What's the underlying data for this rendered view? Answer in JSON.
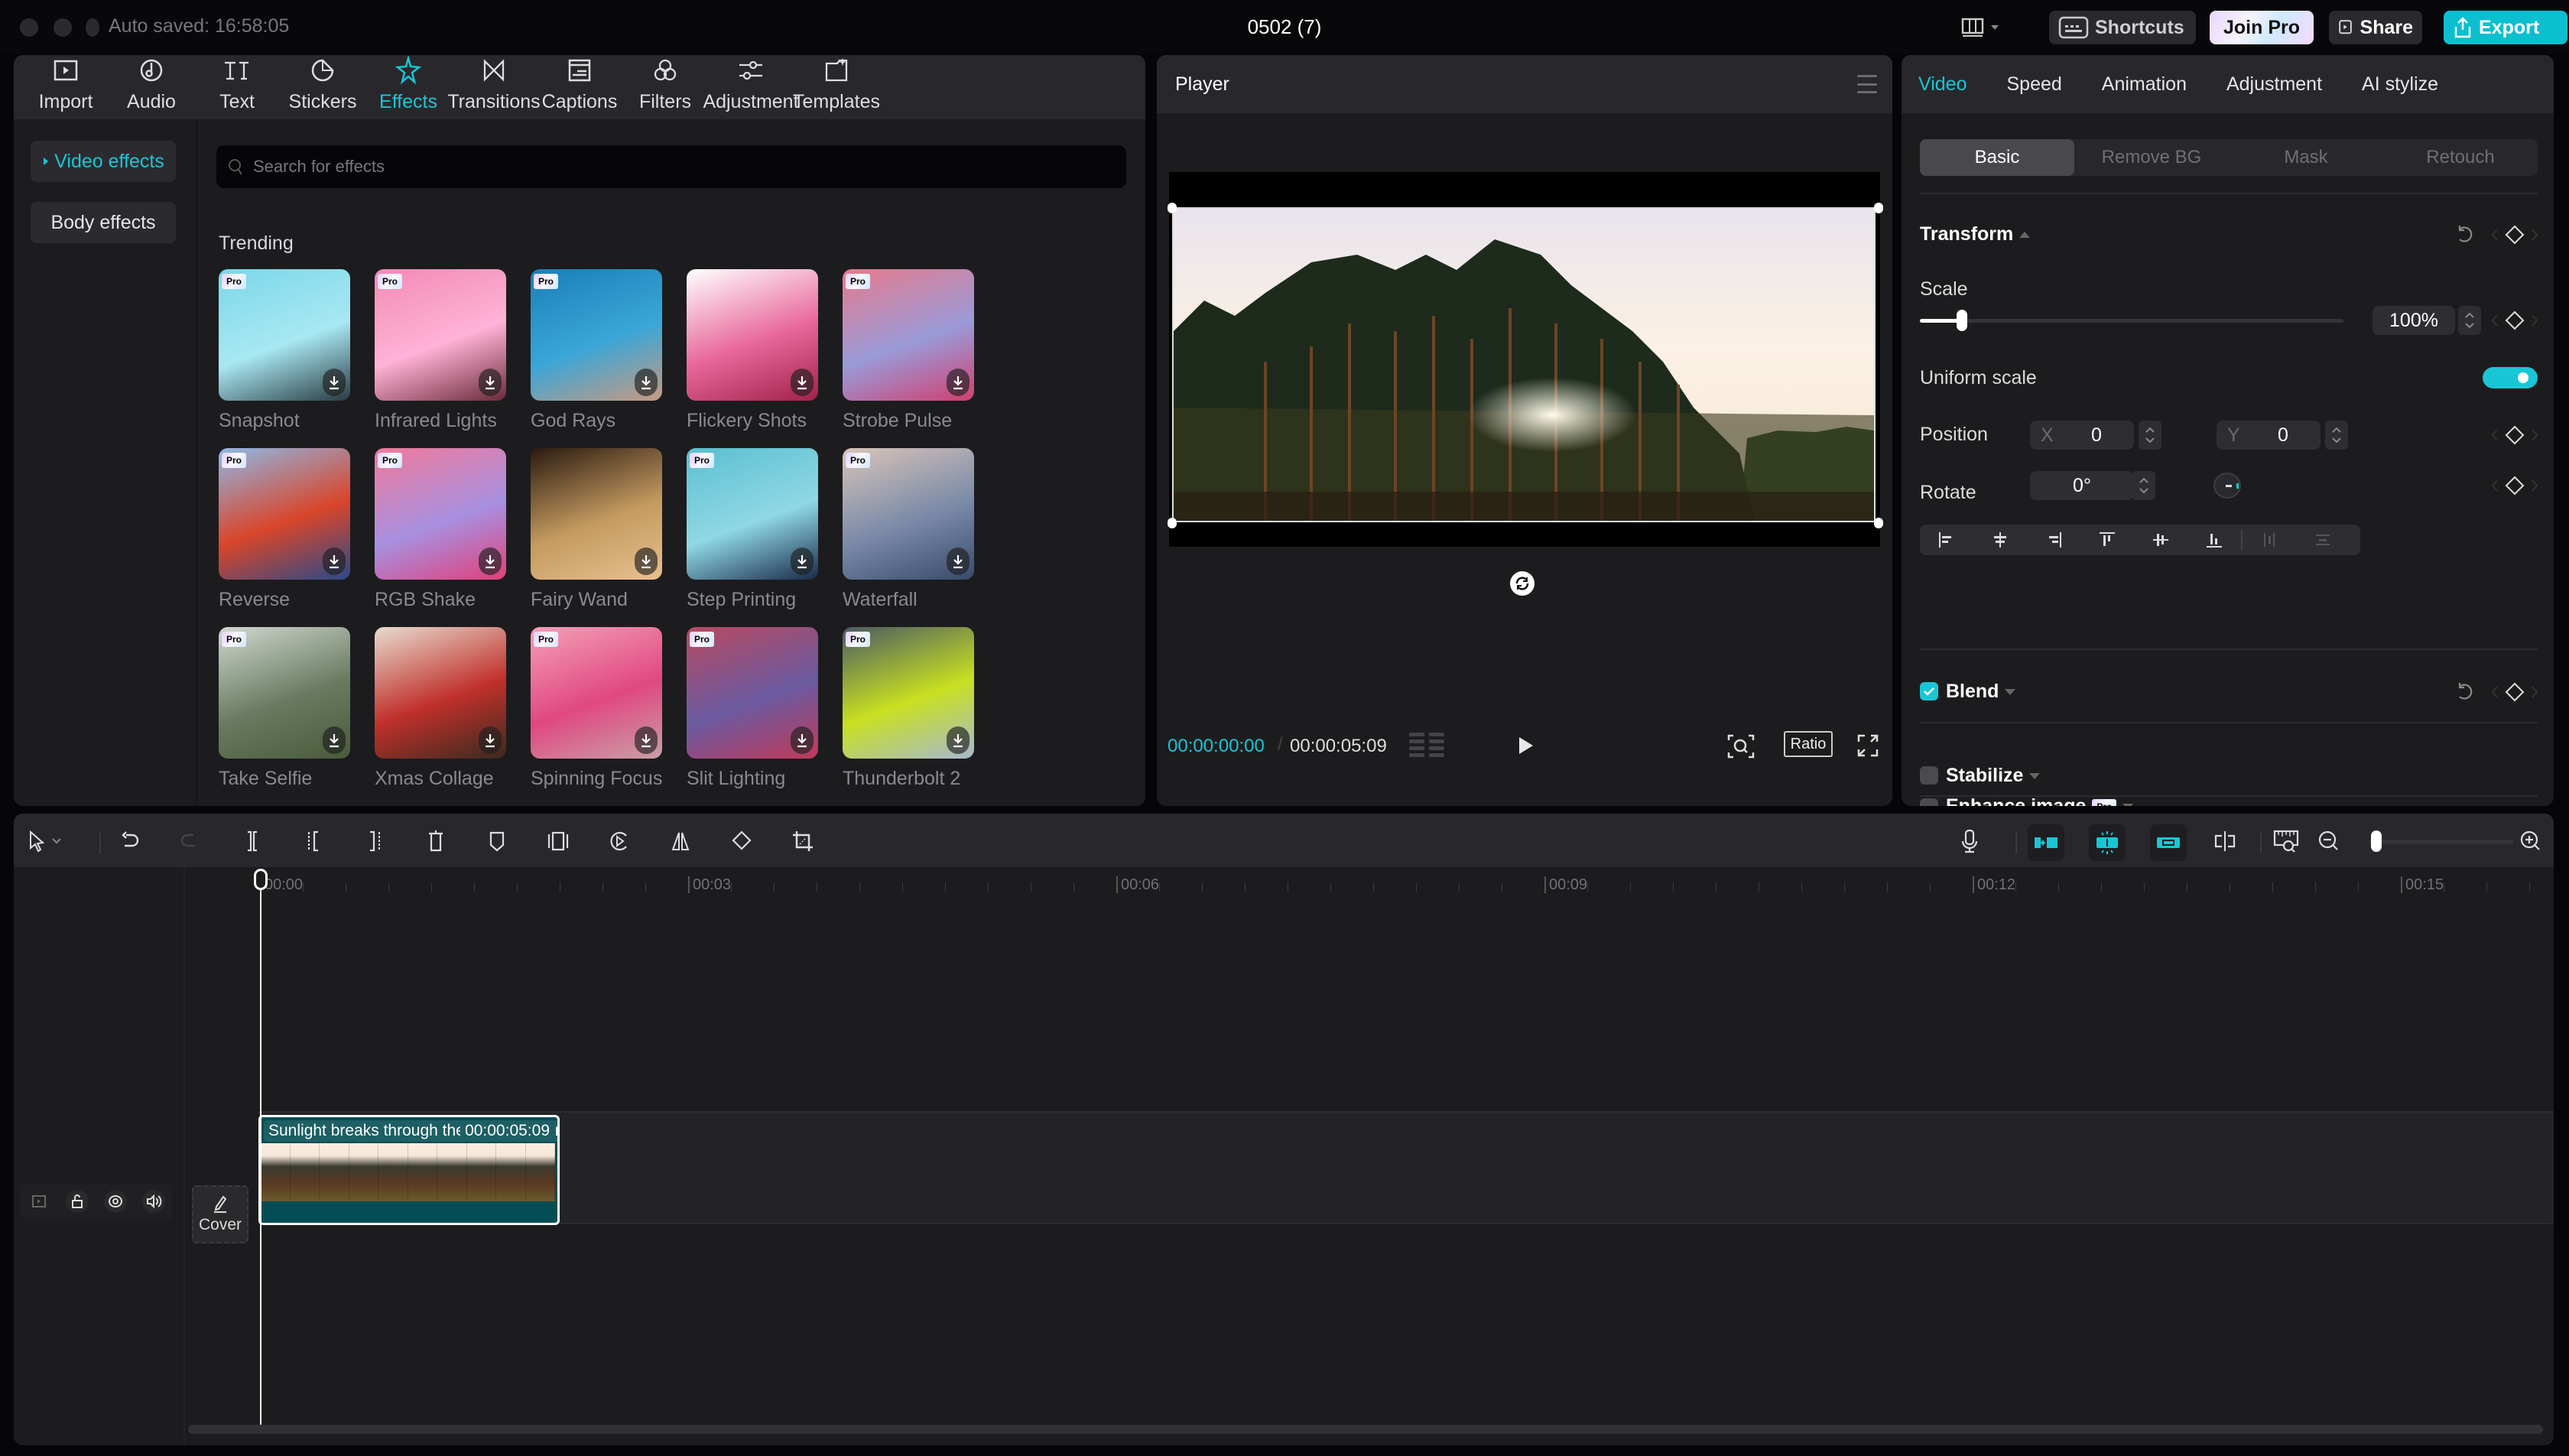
{
  "titlebar": {
    "autosaved": "Auto saved: 16:58:05",
    "title": "0502 (7)",
    "buttons": {
      "shortcuts": "Shortcuts",
      "join_pro": "Join Pro",
      "share": "Share",
      "export": "Export"
    }
  },
  "media_toolbar": {
    "tabs": [
      {
        "label": "Import",
        "icon": "import-icon"
      },
      {
        "label": "Audio",
        "icon": "audio-icon"
      },
      {
        "label": "Text",
        "icon": "text-icon"
      },
      {
        "label": "Stickers",
        "icon": "stickers-icon"
      },
      {
        "label": "Effects",
        "icon": "effects-icon",
        "active": true
      },
      {
        "label": "Transitions",
        "icon": "transitions-icon"
      },
      {
        "label": "Captions",
        "icon": "captions-icon"
      },
      {
        "label": "Filters",
        "icon": "filters-icon"
      },
      {
        "label": "Adjustment",
        "icon": "adjustment-icon"
      },
      {
        "label": "Templates",
        "icon": "templates-icon"
      }
    ]
  },
  "effects_panel": {
    "sidebar": [
      {
        "label": "Video effects",
        "active": true
      },
      {
        "label": "Body effects",
        "active": false
      }
    ],
    "search_placeholder": "Search for effects",
    "section_title": "Trending",
    "pro_badge": "Pro",
    "items": [
      {
        "name": "Snapshot",
        "pro": true
      },
      {
        "name": "Infrared Lights",
        "pro": true
      },
      {
        "name": "God Rays",
        "pro": true
      },
      {
        "name": "Flickery Shots",
        "pro": false
      },
      {
        "name": "Strobe Pulse",
        "pro": true
      },
      {
        "name": "Reverse",
        "pro": true
      },
      {
        "name": "RGB Shake",
        "pro": true
      },
      {
        "name": "Fairy Wand",
        "pro": false
      },
      {
        "name": "Step Printing",
        "pro": true
      },
      {
        "name": "Waterfall",
        "pro": true
      },
      {
        "name": "Take Selfie",
        "pro": true
      },
      {
        "name": "Xmas Collage",
        "pro": false
      },
      {
        "name": "Spinning Focus",
        "pro": true
      },
      {
        "name": "Slit Lighting",
        "pro": true
      },
      {
        "name": "Thunderbolt 2",
        "pro": true
      }
    ]
  },
  "player": {
    "title": "Player",
    "current_time": "00:00:00:00",
    "separator": "/",
    "total_time": "00:00:05:09",
    "ratio_label": "Ratio"
  },
  "properties": {
    "tabs": [
      {
        "label": "Video",
        "active": true
      },
      {
        "label": "Speed"
      },
      {
        "label": "Animation"
      },
      {
        "label": "Adjustment"
      },
      {
        "label": "AI stylize"
      }
    ],
    "subtabs": [
      {
        "label": "Basic",
        "active": true
      },
      {
        "label": "Remove BG"
      },
      {
        "label": "Mask"
      },
      {
        "label": "Retouch"
      }
    ],
    "transform": {
      "title": "Transform",
      "scale_label": "Scale",
      "scale_value": "100%",
      "scale_slider_fraction": 0.1,
      "uniform_scale_label": "Uniform scale",
      "uniform_scale_on": true,
      "position_label": "Position",
      "pos_x_label": "X",
      "pos_x": "0",
      "pos_y_label": "Y",
      "pos_y": "0",
      "rotate_label": "Rotate",
      "rotate_value": "0°"
    },
    "blend": {
      "title": "Blend",
      "checked": true
    },
    "stabilize": {
      "title": "Stabilize",
      "checked": false
    },
    "enhance": {
      "title": "Enhance image",
      "checked": false,
      "badge": "Pro"
    }
  },
  "timeline": {
    "ruler_labels": [
      "00:00",
      "00:03",
      "00:06",
      "00:09",
      "00:12",
      "00:15"
    ],
    "clip": {
      "title": "Sunlight breaks through the crowns of pine trees on a summer sunny evening.",
      "duration": "00:00:05:09"
    },
    "cover_label": "Cover",
    "zoom_fraction": 0.05
  },
  "colors": {
    "accent": "#19c6d6",
    "export_bg": "#0bbfcf",
    "clip_bg": "#044d55",
    "panel_bg": "#1c1c1e",
    "header_bg": "#28282c"
  }
}
